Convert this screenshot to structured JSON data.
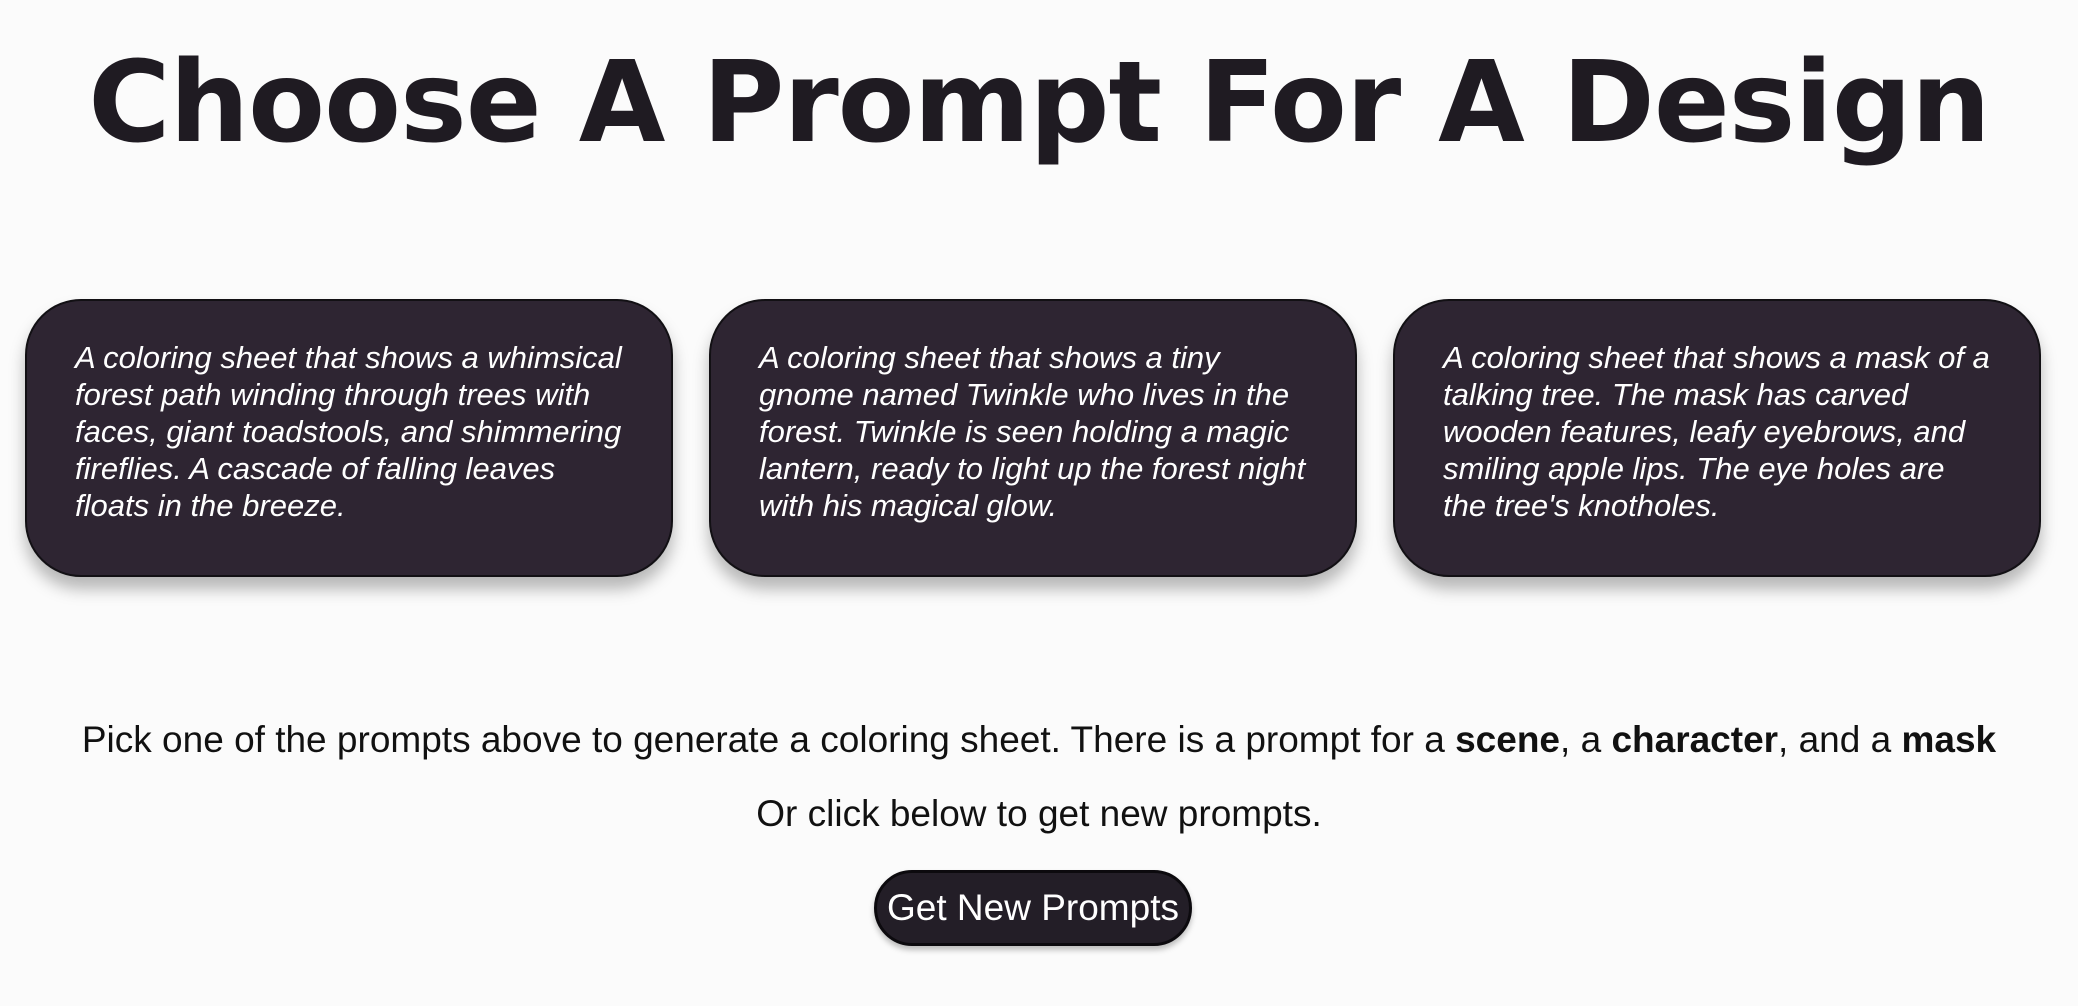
{
  "page": {
    "title": "Choose A Prompt For A Design"
  },
  "prompts": [
    {
      "type": "scene",
      "text": "A coloring sheet that shows a whimsical forest path winding through trees with faces, giant toadstools, and shimmering fireflies. A cascade of falling leaves floats in the breeze."
    },
    {
      "type": "character",
      "text": "A coloring sheet that shows a tiny gnome named Twinkle who lives in the forest. Twinkle is seen holding a magic lantern, ready to light up the forest night with his magical glow."
    },
    {
      "type": "mask",
      "text": "A coloring sheet that shows a mask of a talking tree. The mask has carved wooden features, leafy eyebrows, and smiling apple lips. The eye holes are the tree's knotholes."
    }
  ],
  "instructions": {
    "line1_prefix": "Pick one of the prompts above to generate a coloring sheet. There is a prompt for a ",
    "scene_word": "scene",
    "sep1": ", a ",
    "character_word": "character",
    "sep2": ", and a ",
    "mask_word": "mask",
    "line2": "Or click below to get new prompts."
  },
  "button": {
    "label": "Get New Prompts"
  },
  "colors": {
    "background": "#fbfbfb",
    "card_bg": "#2e2532",
    "title_text": "#1f1b22",
    "button_bg": "#231e27"
  }
}
